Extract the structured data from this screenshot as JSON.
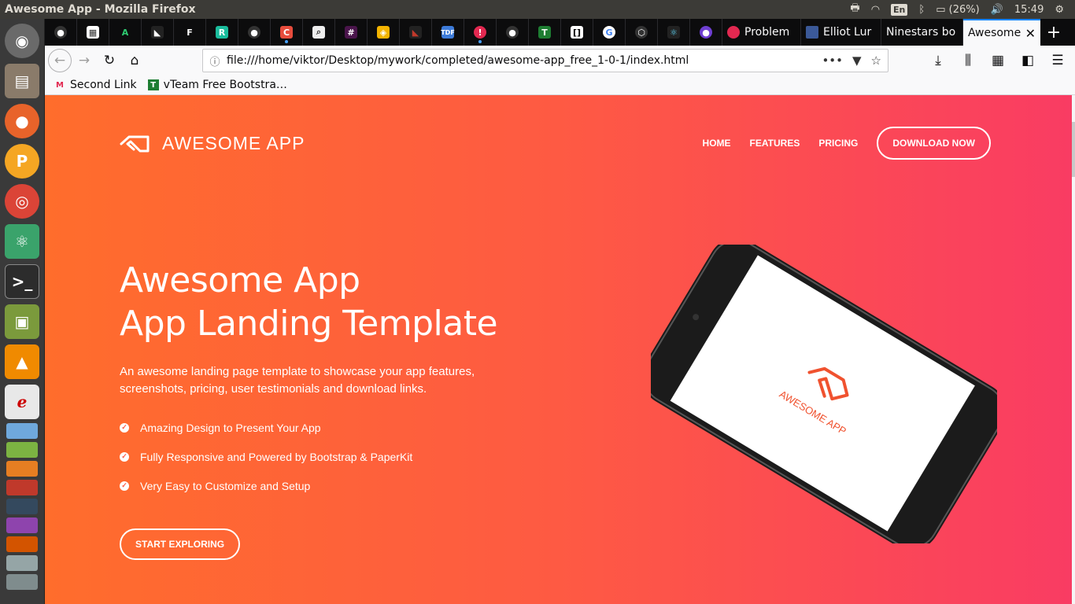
{
  "os": {
    "window_title": "Awesome App - Mozilla Firefox",
    "lang": "En",
    "battery": "(26%)",
    "time": "15:49"
  },
  "browser": {
    "tabs": [
      {
        "label": "Problem",
        "color": "#e22850"
      },
      {
        "label": "Elliot Lur",
        "color": "#3b5998"
      },
      {
        "label": "Ninestars bo",
        "color": "#6a6a6a"
      }
    ],
    "active_tab": "Awesome",
    "url": "file:///home/viktor/Desktop/mywork/completed/awesome-app_free_1-0-1/index.html",
    "bookmarks": [
      {
        "label": "Second Link"
      },
      {
        "label": "vTeam Free Bootstra…"
      }
    ]
  },
  "site": {
    "brand": "AWESOME APP",
    "nav": {
      "home": "HOME",
      "features": "FEATURES",
      "pricing": "PRICING",
      "download": "DOWNLOAD NOW"
    },
    "hero": {
      "title_line1": "Awesome App",
      "title_line2": "App Landing Template",
      "description": "An awesome landing page template to showcase your app features, screenshots, pricing, user testimonials and download links.",
      "features": [
        "Amazing Design to Present Your App",
        "Fully Responsive and Powered by Bootstrap & PaperKit",
        "Very Easy to Customize and Setup"
      ],
      "cta": "START EXPLORING"
    },
    "phone_screen_logo": "AWESOME APP"
  },
  "colors": {
    "gradient_start": "#ff6d2c",
    "gradient_end": "#f93c63",
    "accent": "#fe5a43"
  }
}
